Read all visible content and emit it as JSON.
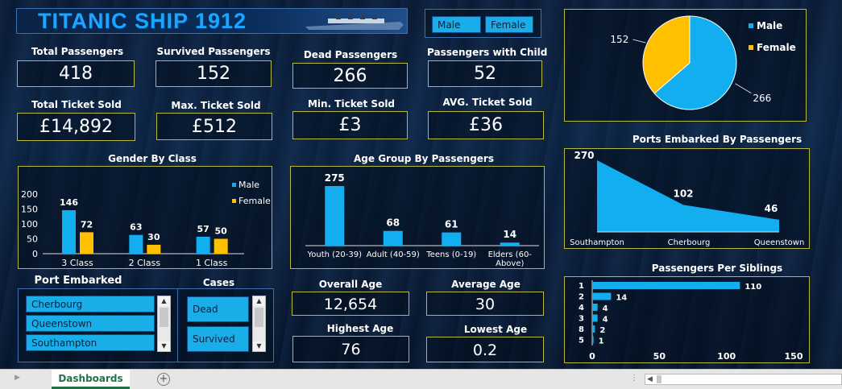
{
  "title": "TITANIC  SHIP 1912",
  "gender_slicer": {
    "options": [
      "Male",
      "Female"
    ]
  },
  "kpis": {
    "total_passengers": {
      "label": "Total Passengers",
      "value": "418"
    },
    "survived_passengers": {
      "label": "Survived Passengers",
      "value": "152"
    },
    "dead_passengers": {
      "label": "Dead Passengers",
      "value": "266"
    },
    "passengers_with_child": {
      "label": "Passengers with Child",
      "value": "52"
    },
    "total_ticket_sold": {
      "label": "Total Ticket Sold",
      "value": "£14,892"
    },
    "max_ticket_sold": {
      "label": "Max. Ticket Sold",
      "value": "£512"
    },
    "min_ticket_sold": {
      "label": "Min. Ticket  Sold",
      "value": "£3"
    },
    "avg_ticket_sold": {
      "label": "AVG. Ticket  Sold",
      "value": "£36"
    }
  },
  "ages": {
    "overall_age": {
      "label": "Overall Age",
      "value": "12,654"
    },
    "average_age": {
      "label": "Average Age",
      "value": "30"
    },
    "highest_age": {
      "label": "Highest Age",
      "value": "76"
    },
    "lowest_age": {
      "label": "Lowest Age",
      "value": "0.2"
    }
  },
  "port_slicer": {
    "title": "Port Embarked",
    "options": [
      "Cherbourg",
      "Queenstown",
      "Southampton"
    ]
  },
  "cases_slicer": {
    "title": "Cases",
    "options": [
      "Dead",
      "Survived"
    ]
  },
  "colors": {
    "male": "#12aef0",
    "female": "#ffc000",
    "box_border": "#b8b83a"
  },
  "sheet_tab": "Dashboards",
  "chart_data": [
    {
      "type": "pie",
      "categories": [
        "Male",
        "Female"
      ],
      "values": [
        266,
        152
      ],
      "legend": "right"
    },
    {
      "type": "bar",
      "title": "Gender By Class",
      "categories": [
        "3 Class",
        "2 Class",
        "1 Class"
      ],
      "series": [
        {
          "name": "Male",
          "values": [
            146,
            63,
            57
          ]
        },
        {
          "name": "Female",
          "values": [
            72,
            30,
            50
          ]
        }
      ],
      "ylim": [
        0,
        200
      ],
      "yticks": [
        "200",
        "150",
        "100",
        "50",
        "0"
      ],
      "legend": "top-right"
    },
    {
      "type": "bar",
      "title": "Age Group By Passengers",
      "categories": [
        "Youth (20-39)",
        "Adult (40-59)",
        "Teens (0-19)",
        "Elders (60-Above)"
      ],
      "values": [
        275,
        68,
        61,
        14
      ]
    },
    {
      "type": "area",
      "title": "Ports Embarked By Passengers",
      "categories": [
        "Southampton",
        "Cherbourg",
        "Queenstown"
      ],
      "values": [
        270,
        102,
        46
      ]
    },
    {
      "type": "bar",
      "orientation": "horizontal",
      "title": "Passengers Per Siblings",
      "categories": [
        "1",
        "2",
        "4",
        "3",
        "8",
        "5"
      ],
      "values": [
        110,
        14,
        4,
        4,
        2,
        1
      ],
      "xlim": [
        0,
        150
      ],
      "xticks": [
        "0",
        "50",
        "100",
        "150"
      ]
    }
  ]
}
